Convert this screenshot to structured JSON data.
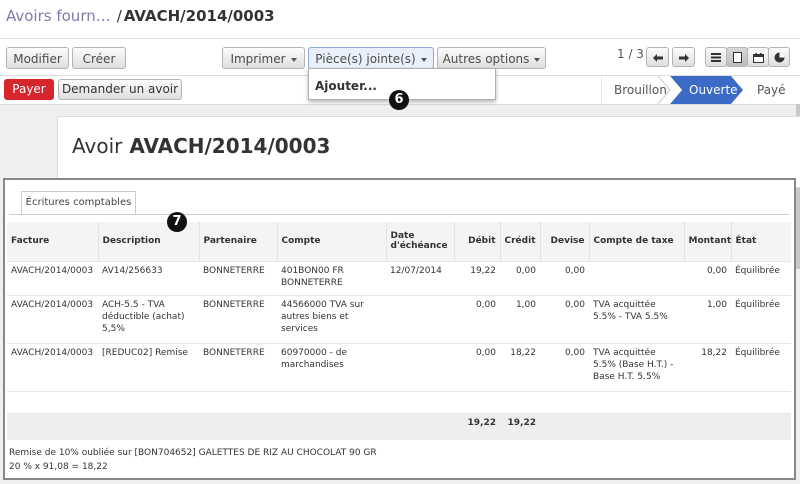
{
  "breadcrumb": {
    "parent": "Avoirs fourn…",
    "separator": "/",
    "current": "AVACH/2014/0003"
  },
  "toolbar": {
    "edit": "Modifier",
    "create": "Créer",
    "print": "Imprimer",
    "attachments": "Pièce(s) jointe(s)",
    "more": "Autres options"
  },
  "pager": {
    "text": "1 / 3"
  },
  "actions": {
    "pay": "Payer",
    "refund": "Demander un avoir"
  },
  "stages": {
    "draft": "Brouillon",
    "open": "Ouverte",
    "paid": "Payé",
    "active": "open"
  },
  "dropdown": {
    "add": "Ajouter..."
  },
  "badges": {
    "six": "6",
    "seven": "7"
  },
  "form": {
    "title_prefix": "Avoir",
    "title": "AVACH/2014/0003"
  },
  "tab": {
    "label": "Écritures comptables"
  },
  "table": {
    "headers": {
      "invoice": "Facture",
      "description": "Description",
      "partner": "Partenaire",
      "account": "Compte",
      "due_date_1": "Date",
      "due_date_2": "d'échéance",
      "debit": "Débit",
      "credit": "Crédit",
      "currency": "Devise",
      "tax_account": "Compte de taxe",
      "amount": "Montant",
      "state": "État"
    },
    "rows": [
      {
        "invoice": "AVACH/2014/0003",
        "description": "AV14/256633",
        "partner": "BONNETERRE",
        "account": "401BON00 FR BONNETERRE",
        "due_date": "12/07/2014",
        "debit": "19,22",
        "credit": "0,00",
        "currency": "0,00",
        "tax_account": "",
        "amount": "0,00",
        "state": "Équilibrée"
      },
      {
        "invoice": "AVACH/2014/0003",
        "description": "ACH-5.5 - TVA déductible (achat) 5,5%",
        "partner": "BONNETERRE",
        "account": "44566000 TVA sur autres biens et services",
        "due_date": "",
        "debit": "0,00",
        "credit": "1,00",
        "currency": "0,00",
        "tax_account": "TVA acquittée 5.5% - TVA 5.5%",
        "amount": "1,00",
        "state": "Équilibrée"
      },
      {
        "invoice": "AVACH/2014/0003",
        "description": "[REDUC02] Remise",
        "partner": "BONNETERRE",
        "account": "60970000 - de marchandises",
        "due_date": "",
        "debit": "0,00",
        "credit": "18,22",
        "currency": "0,00",
        "tax_account": "TVA acquittée 5.5% (Base H.T.) - Base H.T. 5.5%",
        "amount": "18,22",
        "state": "Équilibrée"
      }
    ],
    "totals": {
      "debit": "19,22",
      "credit": "19,22"
    }
  },
  "note": {
    "line1": "Remise de 10% oubliée sur [BON704652] GALETTES DE RIZ AU CHOCOLAT 90 GR",
    "line2": "20 % x 91,08 = 18,22"
  }
}
